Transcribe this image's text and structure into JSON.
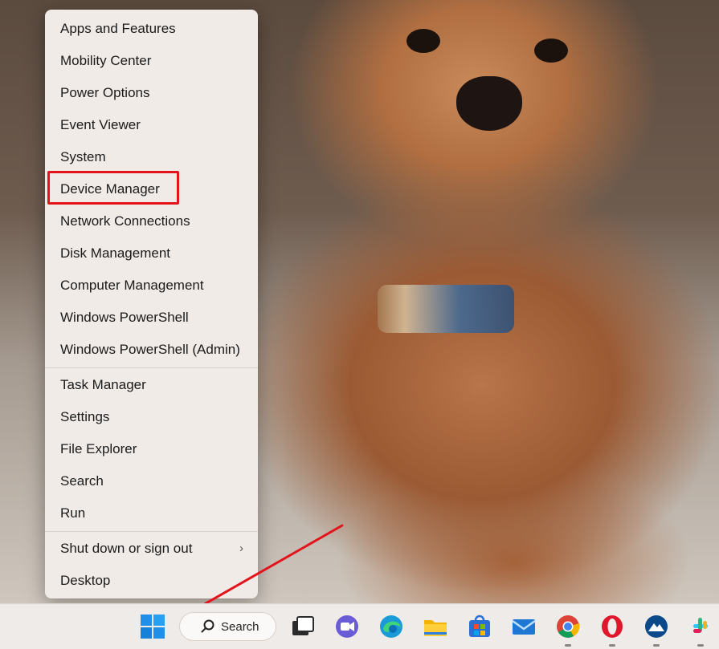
{
  "menu": {
    "groups": [
      [
        "Apps and Features",
        "Mobility Center",
        "Power Options",
        "Event Viewer",
        "System",
        "Device Manager",
        "Network Connections",
        "Disk Management",
        "Computer Management",
        "Windows PowerShell",
        "Windows PowerShell (Admin)"
      ],
      [
        "Task Manager",
        "Settings",
        "File Explorer",
        "Search",
        "Run"
      ],
      [
        "Shut down or sign out",
        "Desktop"
      ]
    ],
    "highlighted": "Device Manager",
    "submenu_indicator": "›"
  },
  "taskbar": {
    "search_label": "Search",
    "icons": [
      "windows-start-icon",
      "search-icon",
      "task-view-icon",
      "meet-video-icon",
      "edge-icon",
      "file-explorer-icon",
      "store-icon",
      "mail-icon",
      "chrome-icon",
      "opera-icon",
      "app-icon",
      "slack-icon"
    ]
  },
  "colors": {
    "highlight": "#e3131b",
    "menu_bg": "#f1ebe7",
    "taskbar_bg": "#efebe8"
  }
}
